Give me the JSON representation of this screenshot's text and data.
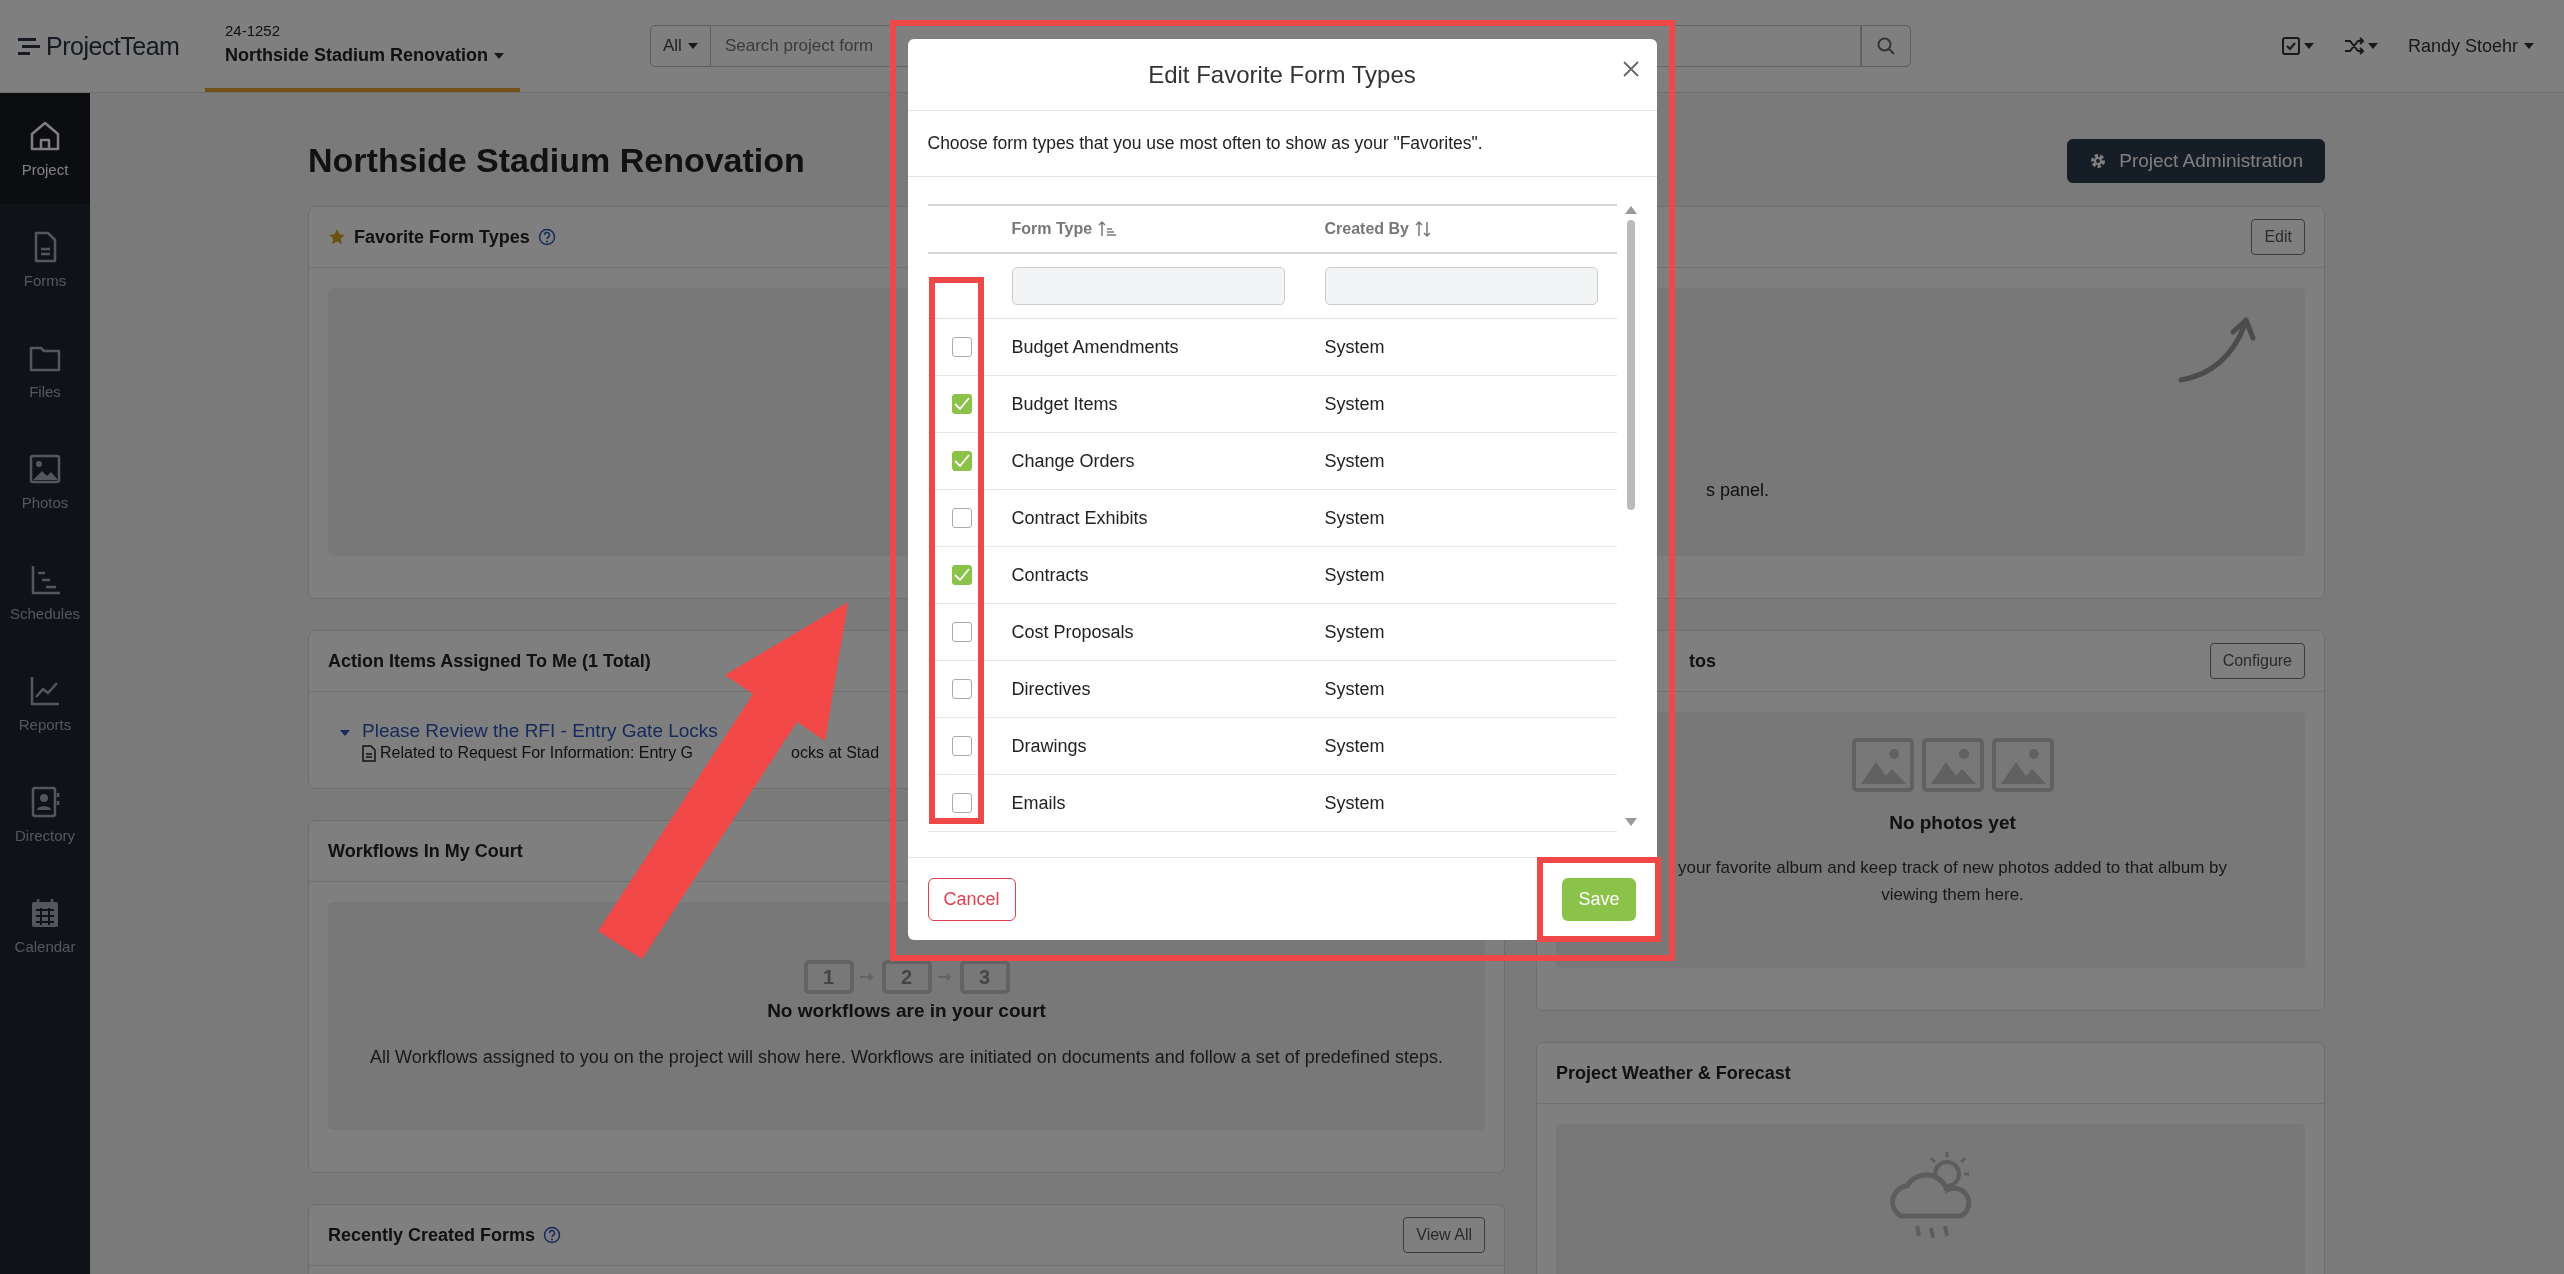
{
  "topbar": {
    "logo": "ProjectTeam",
    "project_number": "24-1252",
    "project_name": "Northside Stadium Renovation",
    "search_scope": "All",
    "search_placeholder": "Search project form",
    "user_name": "Randy Stoehr"
  },
  "sidebar": {
    "items": [
      {
        "label": "Project",
        "selected": true
      },
      {
        "label": "Forms",
        "selected": false
      },
      {
        "label": "Files",
        "selected": false
      },
      {
        "label": "Photos",
        "selected": false
      },
      {
        "label": "Schedules",
        "selected": false
      },
      {
        "label": "Reports",
        "selected": false
      },
      {
        "label": "Directory",
        "selected": false
      },
      {
        "label": "Calendar",
        "selected": false
      }
    ]
  },
  "page": {
    "title": "Northside Stadium Renovation",
    "admin_button": "Project Administration"
  },
  "left_panels": [
    {
      "kind": "favorites",
      "title": "Favorite Form Types",
      "help": true
    },
    {
      "kind": "action_items",
      "title": "Action Items Assigned To Me (1 Total)",
      "help": false,
      "items": [
        {
          "title": "Please Review the RFI - Entry Gate Locks",
          "detail_parts": [
            "Related to Request For Information: Entry G",
            "ocks at Stad"
          ],
          "expanded": true
        }
      ]
    },
    {
      "kind": "workflows",
      "title": "Workflows In My Court",
      "help": false,
      "steps": [
        "1",
        "2",
        "3"
      ],
      "message": "No workflows are in your court",
      "description": "All Workflows assigned to you on the project will show here. Workflows are initiated on documents and follow a set of predefined steps."
    },
    {
      "kind": "recent",
      "title": "Recently Created Forms",
      "help": true,
      "button": "View All"
    }
  ],
  "right_panels": [
    {
      "kind": "links",
      "button": "Edit",
      "message": "s panel."
    },
    {
      "kind": "photos",
      "title": "tos",
      "button": "Configure",
      "message": "No photos yet",
      "description": "your favorite album and keep track of new photos added to that album by viewing them here."
    },
    {
      "kind": "weather",
      "title": "Project Weather & Forecast"
    }
  ],
  "modal": {
    "title": "Edit Favorite Form Types",
    "description": "Choose form types that you use most often to show as your \"Favorites\".",
    "columns": [
      "Form Type",
      "Created By"
    ],
    "rows": [
      {
        "form_type": "Budget Amendments",
        "created_by": "System",
        "checked": false
      },
      {
        "form_type": "Budget Items",
        "created_by": "System",
        "checked": true
      },
      {
        "form_type": "Change Orders",
        "created_by": "System",
        "checked": true
      },
      {
        "form_type": "Contract Exhibits",
        "created_by": "System",
        "checked": false
      },
      {
        "form_type": "Contracts",
        "created_by": "System",
        "checked": true
      },
      {
        "form_type": "Cost Proposals",
        "created_by": "System",
        "checked": false
      },
      {
        "form_type": "Directives",
        "created_by": "System",
        "checked": false
      },
      {
        "form_type": "Drawings",
        "created_by": "System",
        "checked": false
      },
      {
        "form_type": "Emails",
        "created_by": "System",
        "checked": false
      }
    ],
    "cancel_button": "Cancel",
    "save_button": "Save"
  }
}
